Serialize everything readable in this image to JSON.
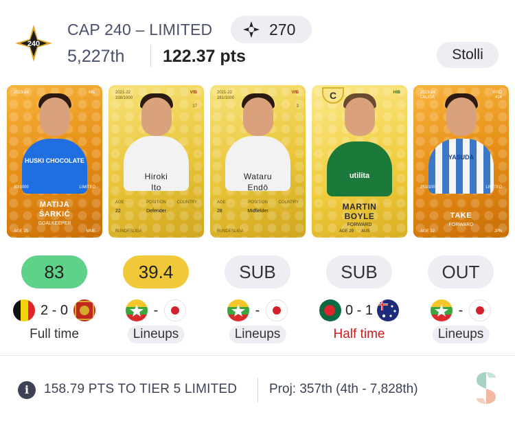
{
  "header": {
    "title": "CAP 240 – LIMITED",
    "logo_text": "240",
    "score_icon": "crosshair-compass-icon",
    "score": "270",
    "rank": "5,227th",
    "points": "122.37 pts",
    "user": "Stolli"
  },
  "cards": [
    {
      "season": "2023-24",
      "club": "MIL",
      "serial": "30/1000",
      "rarity": "LIMITED",
      "first": "MATIJA",
      "last": "ŠARKIĆ",
      "position": "GOALKEEPER",
      "age": "AGE 25",
      "country": "MNE",
      "style": "orange",
      "jersey": "#1f6fe0",
      "sponsor": "HUSKI CHOCOLATE"
    },
    {
      "season": "2021-22",
      "club": "VfB",
      "serial": "338/1000",
      "rarity": "",
      "first": "Hiroki",
      "last": "Ito",
      "position": "Defender",
      "age_label": "AGE",
      "age_value": "22",
      "position_label": "POSITION",
      "country_label": "COUNTRY",
      "style": "gold",
      "league": "BUNDESLIGA",
      "number": "37"
    },
    {
      "season": "2021-22",
      "club": "VfB",
      "serial": "281/1000",
      "rarity": "",
      "first": "Wataru",
      "last": "Endō",
      "position": "Midfielder",
      "age_label": "AGE",
      "age_value": "28",
      "position_label": "POSITION",
      "country_label": "COUNTRY",
      "style": "gold",
      "league": "BUNDESLIGA",
      "number": "3"
    },
    {
      "season": "",
      "club": "HIB",
      "serial": "",
      "rarity": "",
      "captain": "C",
      "first": "MARTIN",
      "last": "BOYLE",
      "position": "FORWARD",
      "age": "AGE 29",
      "country": "AUS",
      "style": "gold",
      "jersey": "#1b7a3a",
      "sponsor": "utilita"
    },
    {
      "season": "2023-24",
      "club": "RSO",
      "serial": "251/1000",
      "rarity": "LIMITED",
      "first": "",
      "last": "TAKE",
      "position": "FORWARD",
      "age": "AGE 22",
      "country": "JPN",
      "style": "orange",
      "jersey": "#3b78c8",
      "sponsor": "YASUDA",
      "league": "LALIGA",
      "number": "#14"
    }
  ],
  "stats": [
    {
      "chip": "83",
      "chip_style": "green",
      "score": "2 - 0",
      "status": "Full time",
      "status_style": "plain",
      "home_flag": "belgium",
      "away_flag": "montenegro"
    },
    {
      "chip": "39.4",
      "chip_style": "yellow",
      "score": "-",
      "status": "Lineups",
      "status_style": "pill",
      "home_flag": "myanmar",
      "away_flag": "japan"
    },
    {
      "chip": "SUB",
      "chip_style": "grey",
      "score": "-",
      "status": "Lineups",
      "status_style": "pill",
      "home_flag": "myanmar",
      "away_flag": "japan"
    },
    {
      "chip": "SUB",
      "chip_style": "grey",
      "score": "0 - 1",
      "status": "Half time",
      "status_style": "red",
      "home_flag": "bangladesh",
      "away_flag": "australia"
    },
    {
      "chip": "OUT",
      "chip_style": "grey",
      "score": "-",
      "status": "Lineups",
      "status_style": "pill",
      "home_flag": "myanmar",
      "away_flag": "japan"
    }
  ],
  "footer": {
    "info_icon": "info-icon",
    "tier_text": "158.79 PTS TO TIER 5 LIMITED",
    "projection": "Proj: 357th (4th - 7,828th)",
    "brand_icon": "sorare-logo-icon"
  },
  "colors": {
    "green": "#5fd28a",
    "yellow": "#f0c93a",
    "grey": "#eceef4",
    "red": "#d21a1a",
    "orange_card": "#e48b12",
    "gold_card": "#e9c437"
  }
}
